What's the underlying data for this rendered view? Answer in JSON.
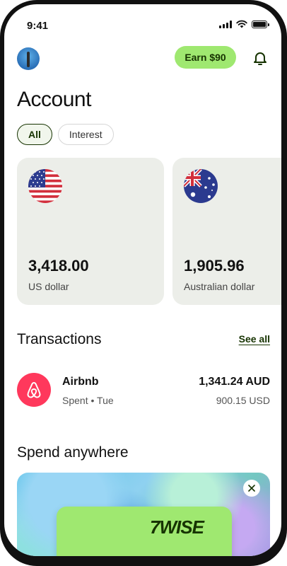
{
  "status_bar": {
    "time": "9:41"
  },
  "header": {
    "earn_label": "Earn $90"
  },
  "page": {
    "title": "Account"
  },
  "filters": [
    {
      "label": "All",
      "active": true
    },
    {
      "label": "Interest",
      "active": false
    }
  ],
  "accounts": [
    {
      "amount": "3,418.00",
      "currency": "US dollar",
      "flag_icon": "us-flag-icon"
    },
    {
      "amount": "1,905.96",
      "currency": "Australian dollar",
      "flag_icon": "australia-flag-icon"
    }
  ],
  "transactions": {
    "title": "Transactions",
    "see_all_label": "See all",
    "items": [
      {
        "merchant": "Airbnb",
        "status": "Spent",
        "day": "Tue",
        "amount": "1,341.24 AUD",
        "converted": "900.15 USD",
        "icon": "airbnb-logo-icon",
        "icon_color": "#ff385c"
      }
    ]
  },
  "promo": {
    "title": "Spend anywhere",
    "logo_text": "WISE",
    "logo_glyph": "7"
  },
  "colors": {
    "accent": "#9fe870",
    "forest": "#163300",
    "card_bg": "#eceee9"
  }
}
